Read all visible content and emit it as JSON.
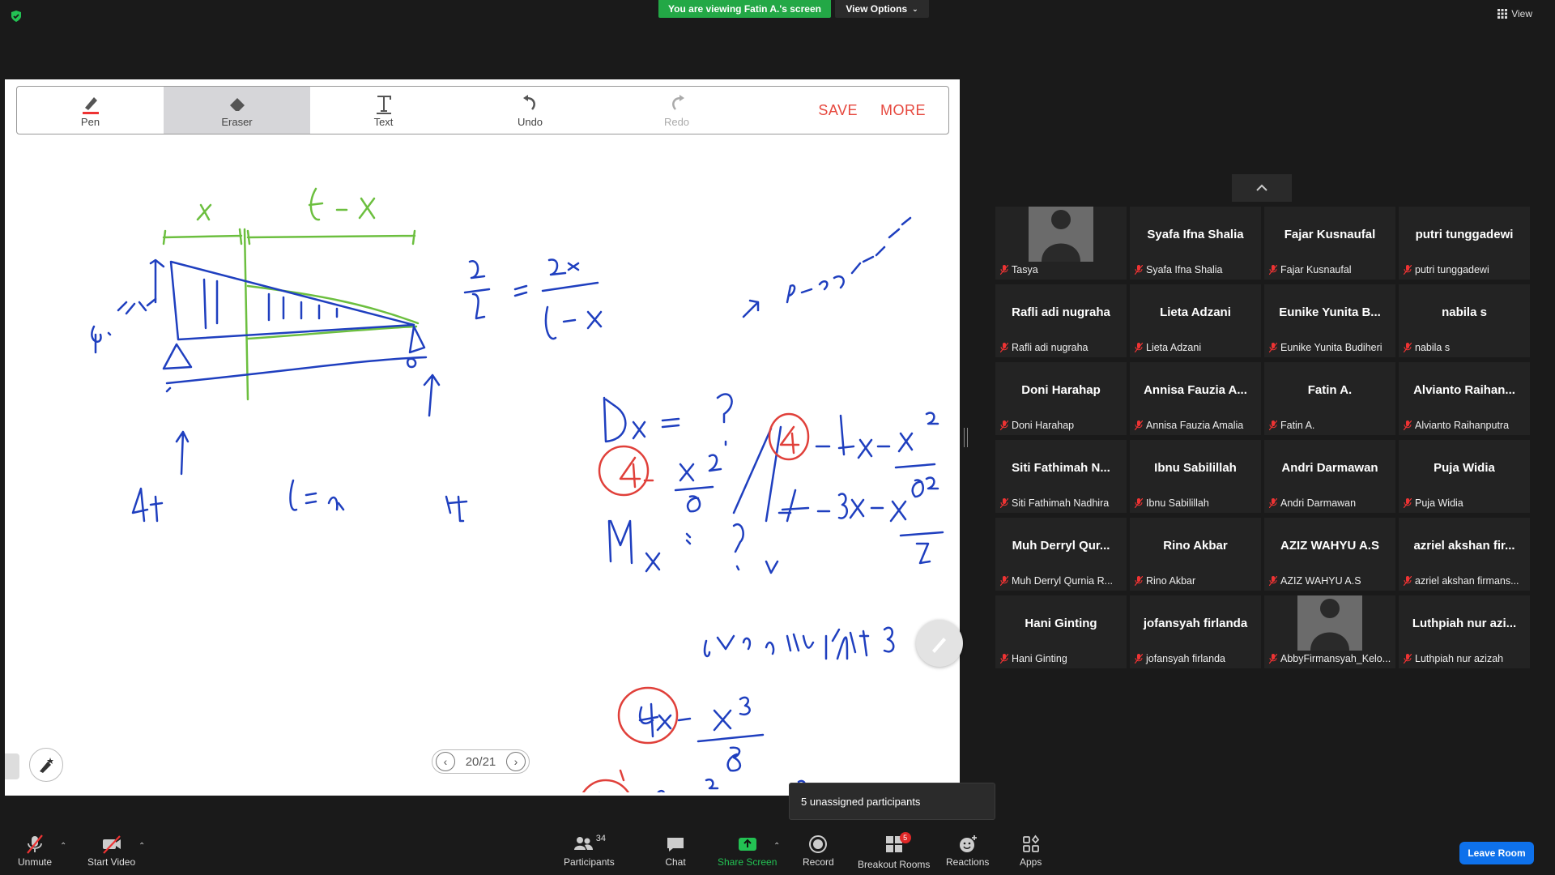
{
  "top": {
    "banner": "You are viewing Fatin A.'s screen",
    "view_options": "View Options",
    "view": "View"
  },
  "whiteboard": {
    "tools": [
      {
        "label": "Pen",
        "icon": "pen-icon"
      },
      {
        "label": "Eraser",
        "icon": "eraser-icon",
        "selected": true
      },
      {
        "label": "Text",
        "icon": "text-icon"
      },
      {
        "label": "Undo",
        "icon": "undo-icon"
      },
      {
        "label": "Redo",
        "icon": "redo-icon",
        "disabled": true
      }
    ],
    "save": "SAVE",
    "more": "MORE",
    "page": "20/21",
    "colors": {
      "ink_blue": "#1f3fbf",
      "ink_green": "#6cbf3f",
      "ink_red": "#e0403a"
    }
  },
  "participants": [
    {
      "big": "",
      "name": "Tasya",
      "photo": true
    },
    {
      "big": "Syafa Ifna Shalia",
      "name": "Syafa Ifna Shalia"
    },
    {
      "big": "Fajar Kusnaufal",
      "name": "Fajar Kusnaufal"
    },
    {
      "big": "putri tunggadewi",
      "name": "putri tunggadewi"
    },
    {
      "big": "Rafli adi nugraha",
      "name": "Rafli adi nugraha"
    },
    {
      "big": "Lieta Adzani",
      "name": "Lieta Adzani"
    },
    {
      "big": "Eunike Yunita B...",
      "name": "Eunike Yunita Budiheri"
    },
    {
      "big": "nabila s",
      "name": "nabila s"
    },
    {
      "big": "Doni Harahap",
      "name": "Doni Harahap"
    },
    {
      "big": "Annisa Fauzia A...",
      "name": "Annisa Fauzia Amalia"
    },
    {
      "big": "Fatin A.",
      "name": "Fatin A."
    },
    {
      "big": "Alvianto Raihan...",
      "name": "Alvianto Raihanputra"
    },
    {
      "big": "Siti Fathimah N...",
      "name": "Siti Fathimah Nadhira"
    },
    {
      "big": "Ibnu Sabilillah",
      "name": "Ibnu Sabilillah"
    },
    {
      "big": "Andri Darmawan",
      "name": "Andri Darmawan"
    },
    {
      "big": "Puja Widia",
      "name": "Puja Widia"
    },
    {
      "big": "Muh Derryl Qur...",
      "name": "Muh Derryl Qurnia R..."
    },
    {
      "big": "Rino Akbar",
      "name": "Rino Akbar"
    },
    {
      "big": "AZIZ WAHYU A.S",
      "name": "AZIZ WAHYU A.S"
    },
    {
      "big": "azriel akshan fir...",
      "name": "azriel akshan firmans..."
    },
    {
      "big": "Hani Ginting",
      "name": "Hani Ginting"
    },
    {
      "big": "jofansyah firlanda",
      "name": "jofansyah firlanda"
    },
    {
      "big": "",
      "name": "AbbyFirmansyah_Kelo...",
      "photo": true
    },
    {
      "big": "Luthpiah nur azi...",
      "name": "Luthpiah nur azizah"
    }
  ],
  "tooltip": "5 unassigned participants",
  "bottom": {
    "unmute": "Unmute",
    "start_video": "Start Video",
    "participants": "Participants",
    "participants_count": "34",
    "chat": "Chat",
    "share_screen": "Share Screen",
    "record": "Record",
    "breakout_rooms": "Breakout Rooms",
    "breakout_badge": "5",
    "reactions": "Reactions",
    "apps": "Apps",
    "leave_room": "Leave Room"
  }
}
